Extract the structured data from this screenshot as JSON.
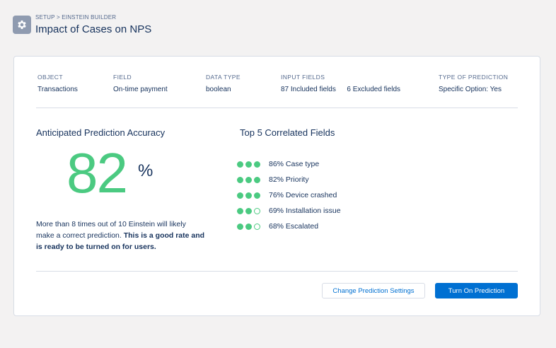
{
  "header": {
    "breadcrumb": "SETUP > EINSTEIN BUILDER",
    "title": "Impact of Cases on NPS",
    "icon": "gear-icon"
  },
  "meta": [
    {
      "label": "OBJECT",
      "value": "Transactions"
    },
    {
      "label": "FIELD",
      "value": "On-time payment"
    },
    {
      "label": "DATA TYPE",
      "value": "boolean"
    },
    {
      "label": "INPUT FIELDS",
      "value_included": "87 Included fields",
      "value_excluded": "6 Excluded fields"
    },
    {
      "label": "TYPE OF PREDICTION",
      "value": "Specific Option: Yes"
    }
  ],
  "accuracy": {
    "title": "Anticipated Prediction Accuracy",
    "value": "82",
    "unit": "%",
    "desc_plain": "More than 8 times out of 10 Einstein will likely make a correct prediction. ",
    "desc_bold": "This is a good rate and is ready to be turned on for users."
  },
  "correlated": {
    "title": "Top 5 Correlated Fields",
    "items": [
      {
        "label": "86% Case type",
        "filled": 3,
        "total": 3
      },
      {
        "label": "82% Priority",
        "filled": 3,
        "total": 3
      },
      {
        "label": "76% Device crashed",
        "filled": 3,
        "total": 3
      },
      {
        "label": "69% Installation issue",
        "filled": 2,
        "total": 3
      },
      {
        "label": "68% Escalated",
        "filled": 2,
        "total": 3
      }
    ]
  },
  "actions": {
    "secondary": "Change Prediction Settings",
    "primary": "Turn On Prediction"
  },
  "colors": {
    "accent_green": "#4bca81",
    "brand_blue": "#0070d2",
    "text_navy": "#16325c"
  }
}
